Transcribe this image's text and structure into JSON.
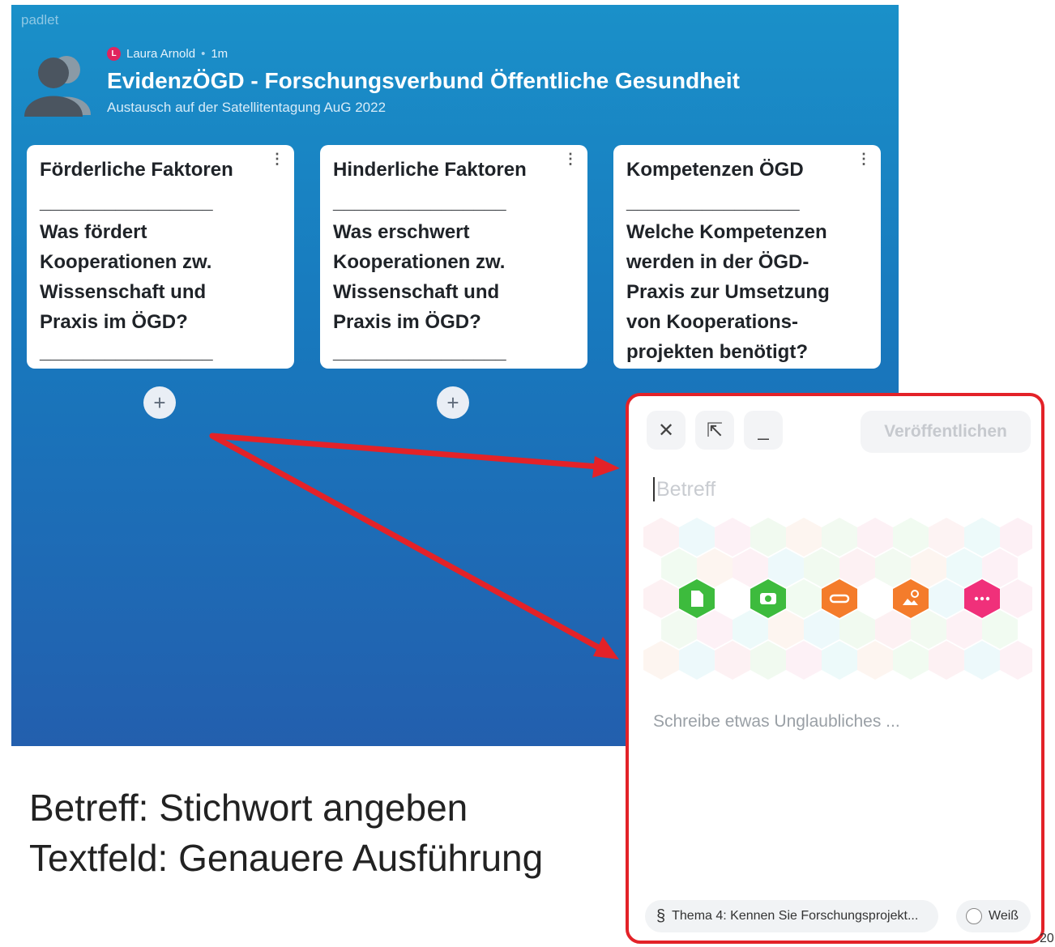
{
  "app": {
    "brand": "padlet"
  },
  "header": {
    "author_initial": "L",
    "author": "Laura Arnold",
    "separator": "•",
    "time": "1m",
    "title": "EvidenzÖGD - Forschungsverbund Öffentliche Gesundheit",
    "subtitle": "Austausch auf der Satellitentagung AuG 2022"
  },
  "columns": [
    {
      "heading": "Förderliche Faktoren",
      "body": "________________\nWas fördert\nKooperationen zw.\nWissenschaft und\nPraxis im ÖGD?\n________________",
      "add": "+"
    },
    {
      "heading": "Hinderliche Faktoren",
      "body": "________________\nWas erschwert\nKooperationen zw.\nWissenschaft und\nPraxis im ÖGD?\n________________",
      "add": "+"
    },
    {
      "heading": "Kompetenzen ÖGD",
      "body": "________________\nWelche Kompetenzen\nwerden in der ÖGD-\nPraxis zur Umsetzung\nvon Kooperations-\nprojekten benötigt?",
      "add": ""
    }
  ],
  "menu_icon": "⋮",
  "caption": {
    "line1": "Betreff: Stichwort angeben",
    "line2": "Textfeld: Genauere Ausführung"
  },
  "composer": {
    "close_icon": "✕",
    "expand_icon": "⇱",
    "minimize_icon": "_",
    "publish_label": "Veröffentlichen",
    "subject_placeholder": "Betreff",
    "body_placeholder": "Schreibe etwas Unglaubliches ...",
    "section_symbol": "§",
    "section_label": "Thema 4: Kennen Sie Forschungsprojekt...",
    "color_label": "Weiß",
    "attachments": [
      {
        "name": "upload-file-icon",
        "color": "#3dbb3d"
      },
      {
        "name": "camera-icon",
        "color": "#3dbb3d"
      },
      {
        "name": "link-icon",
        "color": "#f47c2b"
      },
      {
        "name": "image-search-icon",
        "color": "#f47c2b"
      },
      {
        "name": "more-options-icon",
        "color": "#f0307a"
      }
    ]
  },
  "annotation": {
    "arrow_color": "#e32228",
    "box_color": "#e32228"
  },
  "page_number": "20"
}
